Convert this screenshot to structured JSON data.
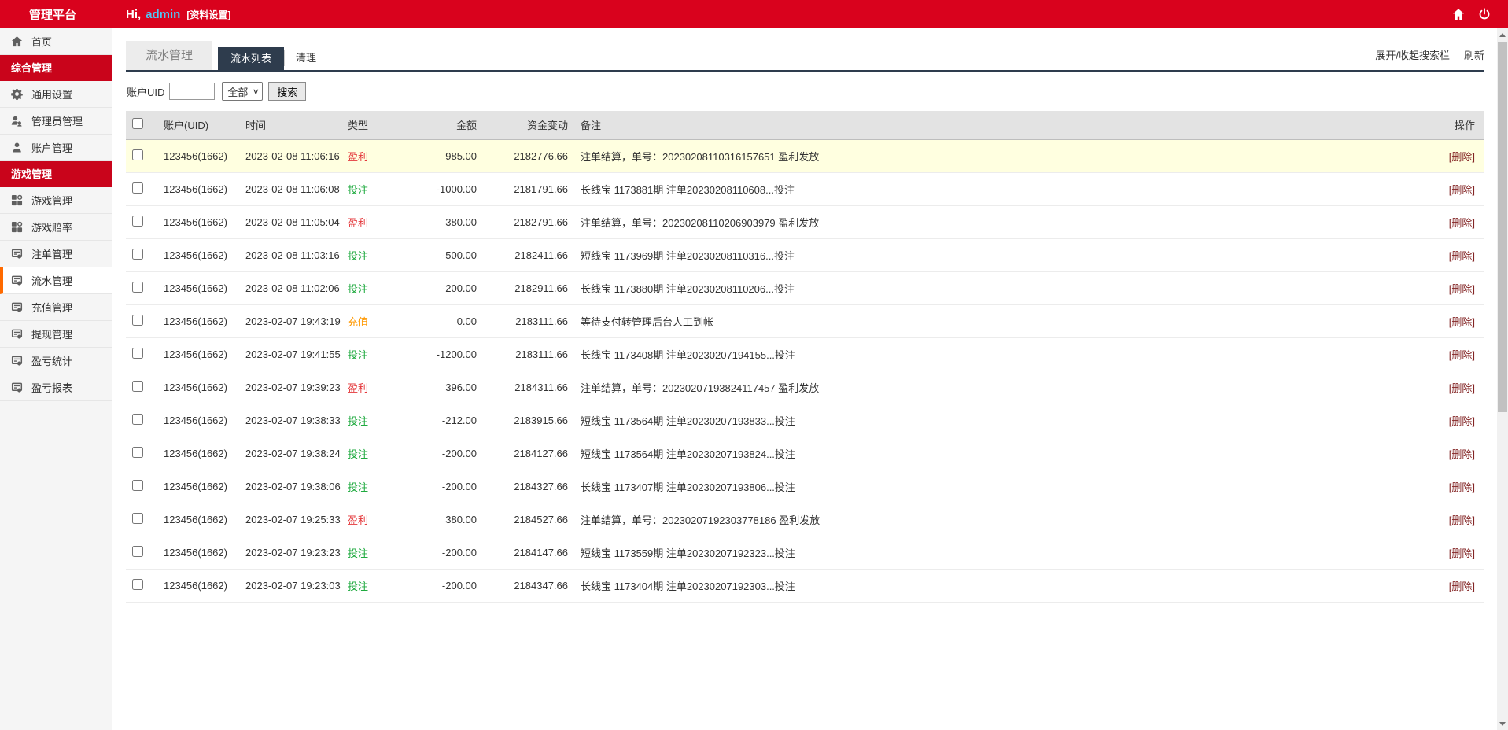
{
  "header": {
    "title": "管理平台",
    "greeting": "Hi,",
    "username": "admin",
    "profile_link": "[资料设置]"
  },
  "sidebar": {
    "items": [
      {
        "label": "首页"
      },
      {
        "label": "综合管理"
      },
      {
        "label": "通用设置"
      },
      {
        "label": "管理员管理"
      },
      {
        "label": "账户管理"
      },
      {
        "label": "游戏管理"
      },
      {
        "label": "游戏管理"
      },
      {
        "label": "游戏赔率"
      },
      {
        "label": "注单管理"
      },
      {
        "label": "流水管理"
      },
      {
        "label": "充值管理"
      },
      {
        "label": "提现管理"
      },
      {
        "label": "盈亏统计"
      },
      {
        "label": "盈亏报表"
      }
    ]
  },
  "main": {
    "page_tab": "流水管理",
    "tabs": {
      "list": "流水列表",
      "clean": "清理"
    },
    "toolbar": {
      "toggle_search": "展开/收起搜索栏",
      "refresh": "刷新"
    },
    "search": {
      "label": "账户UID",
      "filter_value": "全部",
      "button": "搜索"
    },
    "table": {
      "columns": {
        "uid": "账户(UID)",
        "time": "时间",
        "type": "类型",
        "amount": "金额",
        "balance": "资金变动",
        "remark": "备注",
        "action": "操作"
      },
      "rows": [
        {
          "row_class": "hl",
          "uid": "123456(1662)",
          "time": "2023-02-08 11:06:16",
          "type": "盈利",
          "type_class": "t-profit",
          "amount": "985.00",
          "balance": "2182776.66",
          "remark": "注单结算，单号：20230208110316157651 盈利发放",
          "action": "[删除]"
        },
        {
          "row_class": "",
          "uid": "123456(1662)",
          "time": "2023-02-08 11:06:08",
          "type": "投注",
          "type_class": "t-bet",
          "amount": "-1000.00",
          "balance": "2181791.66",
          "remark": "长线宝 1173881期 注单20230208110608...投注",
          "action": "[删除]"
        },
        {
          "row_class": "",
          "uid": "123456(1662)",
          "time": "2023-02-08 11:05:04",
          "type": "盈利",
          "type_class": "t-profit",
          "amount": "380.00",
          "balance": "2182791.66",
          "remark": "注单结算，单号：20230208110206903979 盈利发放",
          "action": "[删除]"
        },
        {
          "row_class": "",
          "uid": "123456(1662)",
          "time": "2023-02-08 11:03:16",
          "type": "投注",
          "type_class": "t-bet",
          "amount": "-500.00",
          "balance": "2182411.66",
          "remark": "短线宝 1173969期 注单20230208110316...投注",
          "action": "[删除]"
        },
        {
          "row_class": "",
          "uid": "123456(1662)",
          "time": "2023-02-08 11:02:06",
          "type": "投注",
          "type_class": "t-bet",
          "amount": "-200.00",
          "balance": "2182911.66",
          "remark": "长线宝 1173880期 注单20230208110206...投注",
          "action": "[删除]"
        },
        {
          "row_class": "",
          "uid": "123456(1662)",
          "time": "2023-02-07 19:43:19",
          "type": "充值",
          "type_class": "t-recharge",
          "amount": "0.00",
          "balance": "2183111.66",
          "remark": "等待支付转管理后台人工到帐",
          "action": "[删除]"
        },
        {
          "row_class": "",
          "uid": "123456(1662)",
          "time": "2023-02-07 19:41:55",
          "type": "投注",
          "type_class": "t-bet",
          "amount": "-1200.00",
          "balance": "2183111.66",
          "remark": "长线宝 1173408期 注单20230207194155...投注",
          "action": "[删除]"
        },
        {
          "row_class": "",
          "uid": "123456(1662)",
          "time": "2023-02-07 19:39:23",
          "type": "盈利",
          "type_class": "t-profit",
          "amount": "396.00",
          "balance": "2184311.66",
          "remark": "注单结算，单号：20230207193824117457 盈利发放",
          "action": "[删除]"
        },
        {
          "row_class": "",
          "uid": "123456(1662)",
          "time": "2023-02-07 19:38:33",
          "type": "投注",
          "type_class": "t-bet",
          "amount": "-212.00",
          "balance": "2183915.66",
          "remark": "短线宝 1173564期 注单20230207193833...投注",
          "action": "[删除]"
        },
        {
          "row_class": "",
          "uid": "123456(1662)",
          "time": "2023-02-07 19:38:24",
          "type": "投注",
          "type_class": "t-bet",
          "amount": "-200.00",
          "balance": "2184127.66",
          "remark": "短线宝 1173564期 注单20230207193824...投注",
          "action": "[删除]"
        },
        {
          "row_class": "",
          "uid": "123456(1662)",
          "time": "2023-02-07 19:38:06",
          "type": "投注",
          "type_class": "t-bet",
          "amount": "-200.00",
          "balance": "2184327.66",
          "remark": "长线宝 1173407期 注单20230207193806...投注",
          "action": "[删除]"
        },
        {
          "row_class": "",
          "uid": "123456(1662)",
          "time": "2023-02-07 19:25:33",
          "type": "盈利",
          "type_class": "t-profit",
          "amount": "380.00",
          "balance": "2184527.66",
          "remark": "注单结算，单号：20230207192303778186 盈利发放",
          "action": "[删除]"
        },
        {
          "row_class": "",
          "uid": "123456(1662)",
          "time": "2023-02-07 19:23:23",
          "type": "投注",
          "type_class": "t-bet",
          "amount": "-200.00",
          "balance": "2184147.66",
          "remark": "短线宝 1173559期 注单20230207192323...投注",
          "action": "[删除]"
        },
        {
          "row_class": "",
          "uid": "123456(1662)",
          "time": "2023-02-07 19:23:03",
          "type": "投注",
          "type_class": "t-bet",
          "amount": "-200.00",
          "balance": "2184347.66",
          "remark": "长线宝 1173404期 注单20230207192303...投注",
          "action": "[删除]"
        }
      ]
    }
  },
  "colors": {
    "header_red": "#d9021d",
    "section_red": "#c9041b",
    "username_blue": "#4fc7f7",
    "tab_dark": "#2e3c4d",
    "active_stripe_orange": "#ff6a00",
    "type_profit_red": "#e4393c",
    "type_bet_green": "#1faa3f",
    "type_recharge_orange": "#ff9800",
    "delete_link": "#832424",
    "highlight_row": "#ffffe0"
  }
}
